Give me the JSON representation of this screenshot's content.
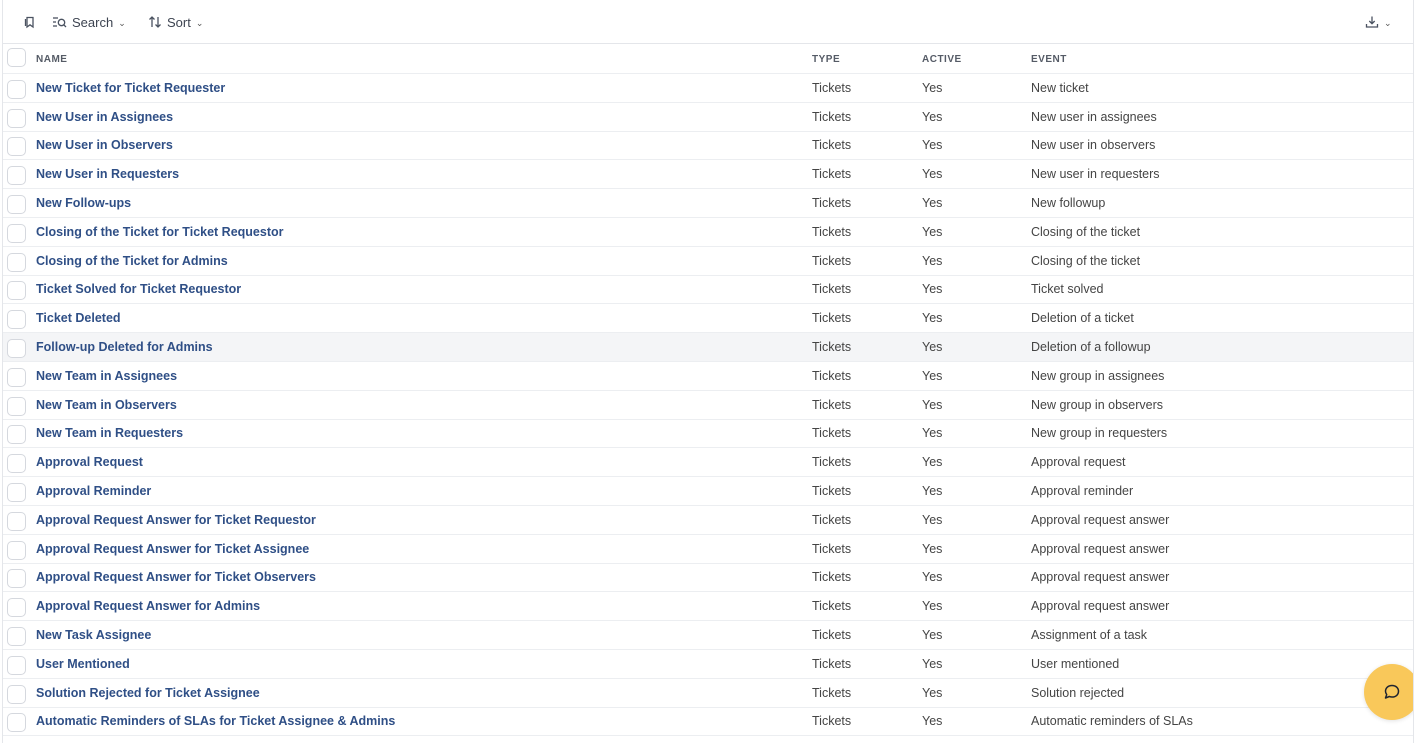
{
  "toolbar": {
    "bookmark_icon": "bookmark-icon",
    "search_label": "Search",
    "sort_label": "Sort",
    "export_icon": "download-icon"
  },
  "table": {
    "headers": {
      "name": "NAME",
      "type": "TYPE",
      "active": "ACTIVE",
      "event": "EVENT"
    },
    "rows": [
      {
        "name": "New Ticket for Ticket Requester",
        "type": "Tickets",
        "active": "Yes",
        "event": "New ticket"
      },
      {
        "name": "New User in Assignees",
        "type": "Tickets",
        "active": "Yes",
        "event": "New user in assignees"
      },
      {
        "name": "New User in Observers",
        "type": "Tickets",
        "active": "Yes",
        "event": "New user in observers"
      },
      {
        "name": "New User in Requesters",
        "type": "Tickets",
        "active": "Yes",
        "event": "New user in requesters"
      },
      {
        "name": "New Follow-ups",
        "type": "Tickets",
        "active": "Yes",
        "event": "New followup"
      },
      {
        "name": "Closing of the Ticket for Ticket Requestor",
        "type": "Tickets",
        "active": "Yes",
        "event": "Closing of the ticket"
      },
      {
        "name": "Closing of the Ticket for Admins",
        "type": "Tickets",
        "active": "Yes",
        "event": "Closing of the ticket"
      },
      {
        "name": "Ticket Solved for Ticket Requestor",
        "type": "Tickets",
        "active": "Yes",
        "event": "Ticket solved"
      },
      {
        "name": "Ticket Deleted",
        "type": "Tickets",
        "active": "Yes",
        "event": "Deletion of a ticket"
      },
      {
        "name": "Follow-up Deleted for Admins",
        "type": "Tickets",
        "active": "Yes",
        "event": "Deletion of a followup"
      },
      {
        "name": "New Team in Assignees",
        "type": "Tickets",
        "active": "Yes",
        "event": "New group in assignees"
      },
      {
        "name": "New Team in Observers",
        "type": "Tickets",
        "active": "Yes",
        "event": "New group in observers"
      },
      {
        "name": "New Team in Requesters",
        "type": "Tickets",
        "active": "Yes",
        "event": "New group in requesters"
      },
      {
        "name": "Approval Request",
        "type": "Tickets",
        "active": "Yes",
        "event": "Approval request"
      },
      {
        "name": "Approval Reminder",
        "type": "Tickets",
        "active": "Yes",
        "event": "Approval reminder"
      },
      {
        "name": "Approval Request Answer for Ticket Requestor",
        "type": "Tickets",
        "active": "Yes",
        "event": "Approval request answer"
      },
      {
        "name": "Approval Request Answer for Ticket Assignee",
        "type": "Tickets",
        "active": "Yes",
        "event": "Approval request answer"
      },
      {
        "name": "Approval Request Answer for Ticket Observers",
        "type": "Tickets",
        "active": "Yes",
        "event": "Approval request answer"
      },
      {
        "name": "Approval Request Answer for Admins",
        "type": "Tickets",
        "active": "Yes",
        "event": "Approval request answer"
      },
      {
        "name": "New Task Assignee",
        "type": "Tickets",
        "active": "Yes",
        "event": "Assignment of a task"
      },
      {
        "name": "User Mentioned",
        "type": "Tickets",
        "active": "Yes",
        "event": "User mentioned"
      },
      {
        "name": "Solution Rejected for Ticket Assignee",
        "type": "Tickets",
        "active": "Yes",
        "event": "Solution rejected"
      },
      {
        "name": "Automatic Reminders of SLAs for Ticket Assignee & Admins",
        "type": "Tickets",
        "active": "Yes",
        "event": "Automatic reminders of SLAs"
      }
    ]
  },
  "fab": {
    "icon": "chat-bubble-icon",
    "color": "#f9c85a"
  }
}
